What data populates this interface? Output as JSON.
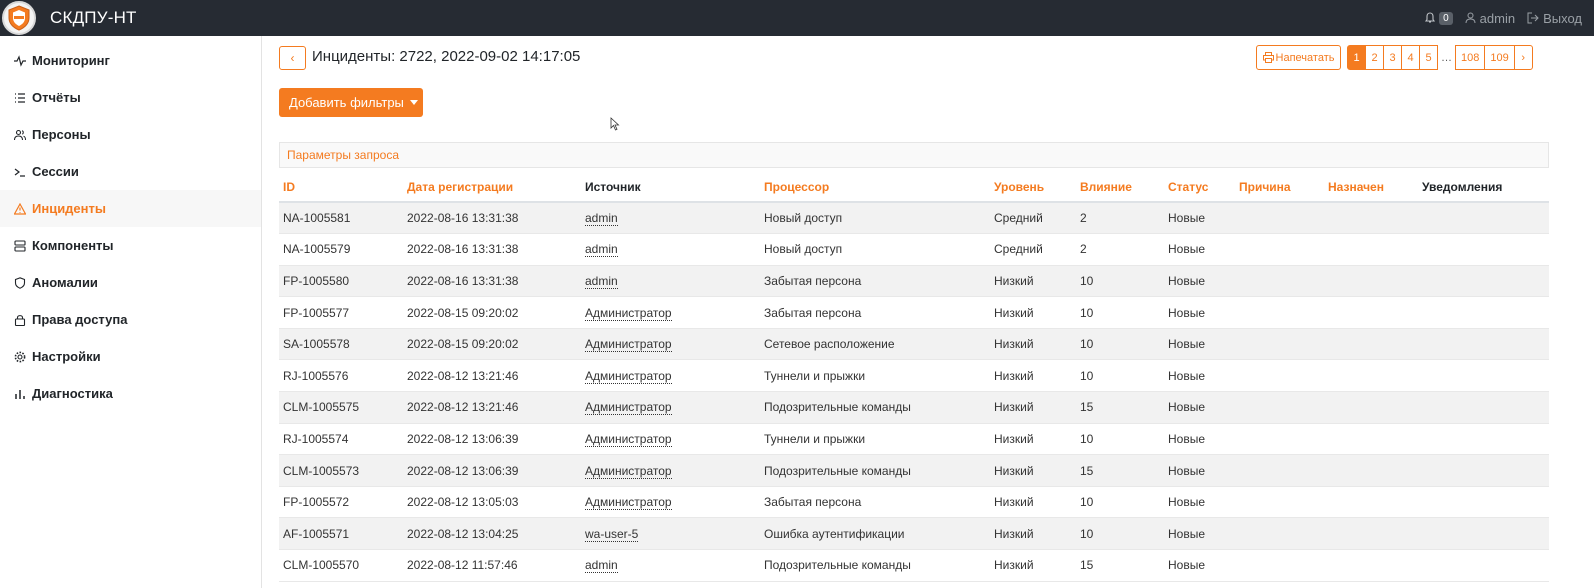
{
  "app": {
    "title": "СКДПУ-НТ",
    "notifications_count": "0",
    "user": "admin",
    "logout": "Выход"
  },
  "sidebar": {
    "items": [
      {
        "label": "Мониторинг",
        "icon": "activity-icon"
      },
      {
        "label": "Отчёты",
        "icon": "list-icon"
      },
      {
        "label": "Персоны",
        "icon": "users-icon"
      },
      {
        "label": "Сессии",
        "icon": "terminal-icon"
      },
      {
        "label": "Инциденты",
        "icon": "alert-triangle-icon",
        "active": true
      },
      {
        "label": "Компоненты",
        "icon": "server-icon"
      },
      {
        "label": "Аномалии",
        "icon": "shield-icon"
      },
      {
        "label": "Права доступа",
        "icon": "lock-icon"
      },
      {
        "label": "Настройки",
        "icon": "gear-icon"
      },
      {
        "label": "Диагностика",
        "icon": "bar-chart-icon"
      }
    ]
  },
  "main": {
    "title": "Инциденты: 2722, 2022-09-02 14:17:05",
    "print_label": "Напечатать",
    "pages": [
      "1",
      "2",
      "3",
      "4",
      "5",
      "…",
      "108",
      "109"
    ],
    "active_page": "1",
    "add_filter_label": "Добавить фильтры",
    "params_label": "Параметры запроса"
  },
  "table": {
    "columns": [
      "ID",
      "Дата регистрации",
      "Источник",
      "Процессор",
      "Уровень",
      "Влияние",
      "Статус",
      "Причина",
      "Назначен",
      "Уведомления"
    ],
    "rows": [
      [
        "NA-1005581",
        "2022-08-16 13:31:38",
        "admin",
        "Новый доступ",
        "Средний",
        "2",
        "Новые",
        "",
        "",
        ""
      ],
      [
        "NA-1005579",
        "2022-08-16 13:31:38",
        "admin",
        "Новый доступ",
        "Средний",
        "2",
        "Новые",
        "",
        "",
        ""
      ],
      [
        "FP-1005580",
        "2022-08-16 13:31:38",
        "admin",
        "Забытая персона",
        "Низкий",
        "10",
        "Новые",
        "",
        "",
        ""
      ],
      [
        "FP-1005577",
        "2022-08-15 09:20:02",
        "Администратор",
        "Забытая персона",
        "Низкий",
        "10",
        "Новые",
        "",
        "",
        ""
      ],
      [
        "SA-1005578",
        "2022-08-15 09:20:02",
        "Администратор",
        "Сетевое расположение",
        "Низкий",
        "10",
        "Новые",
        "",
        "",
        ""
      ],
      [
        "RJ-1005576",
        "2022-08-12 13:21:46",
        "Администратор",
        "Туннели и прыжки",
        "Низкий",
        "10",
        "Новые",
        "",
        "",
        ""
      ],
      [
        "CLM-1005575",
        "2022-08-12 13:21:46",
        "Администратор",
        "Подозрительные команды",
        "Низкий",
        "15",
        "Новые",
        "",
        "",
        ""
      ],
      [
        "RJ-1005574",
        "2022-08-12 13:06:39",
        "Администратор",
        "Туннели и прыжки",
        "Низкий",
        "10",
        "Новые",
        "",
        "",
        ""
      ],
      [
        "CLM-1005573",
        "2022-08-12 13:06:39",
        "Администратор",
        "Подозрительные команды",
        "Низкий",
        "15",
        "Новые",
        "",
        "",
        ""
      ],
      [
        "FP-1005572",
        "2022-08-12 13:05:03",
        "Администратор",
        "Забытая персона",
        "Низкий",
        "10",
        "Новые",
        "",
        "",
        ""
      ],
      [
        "AF-1005571",
        "2022-08-12 13:04:25",
        "wa-user-5",
        "Ошибка аутентификации",
        "Низкий",
        "10",
        "Новые",
        "",
        "",
        ""
      ],
      [
        "CLM-1005570",
        "2022-08-12 11:57:46",
        "admin",
        "Подозрительные команды",
        "Низкий",
        "15",
        "Новые",
        "",
        "",
        ""
      ]
    ]
  }
}
